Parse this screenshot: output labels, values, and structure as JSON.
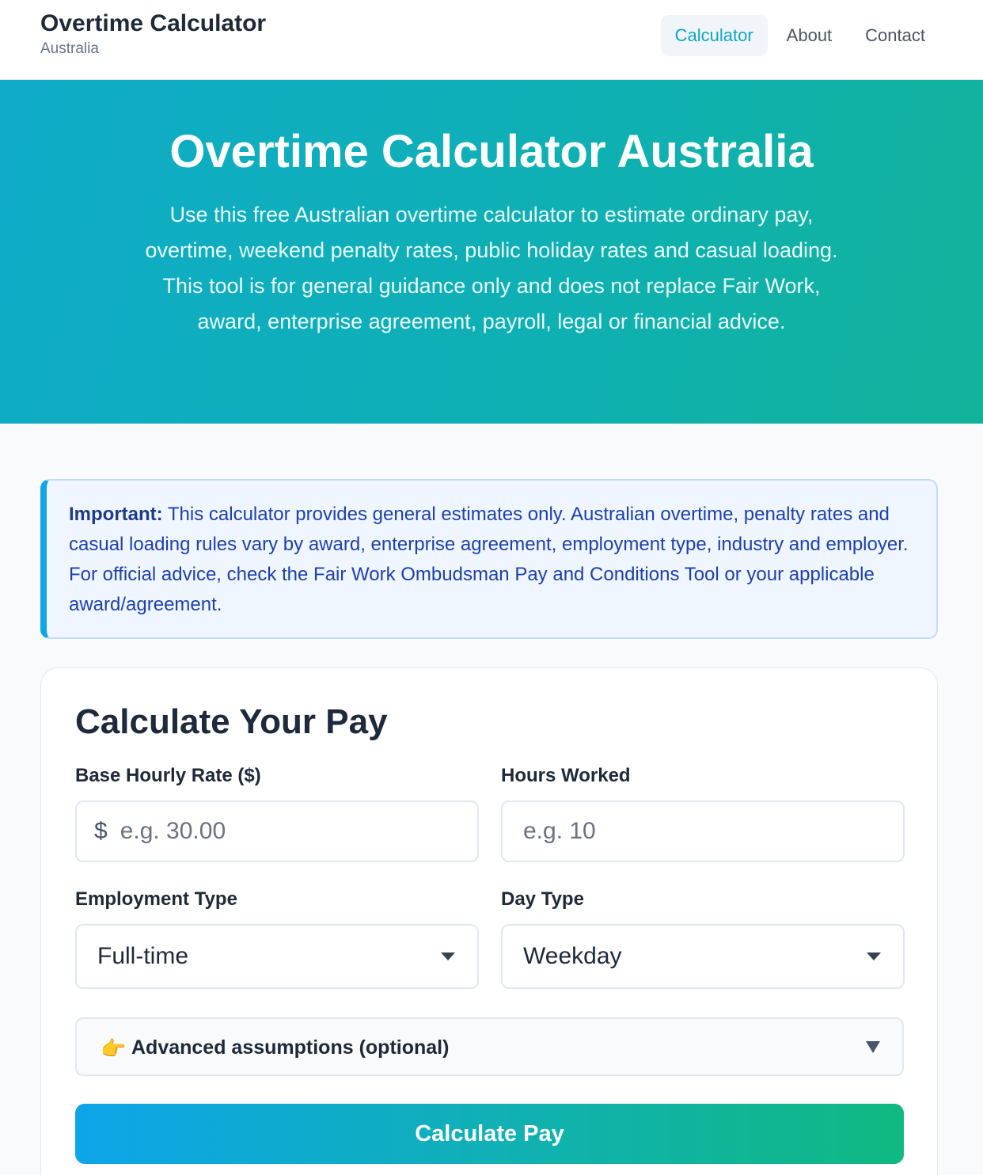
{
  "header": {
    "title": "Overtime Calculator",
    "subtitle": "Australia",
    "nav": [
      {
        "label": "Calculator",
        "active": true
      },
      {
        "label": "About",
        "active": false
      },
      {
        "label": "Contact",
        "active": false
      }
    ]
  },
  "hero": {
    "title": "Overtime Calculator Australia",
    "description": "Use this free Australian overtime calculator to estimate ordinary pay, overtime, weekend penalty rates, public holiday rates and casual loading. This tool is for general guidance only and does not replace Fair Work, award, enterprise agreement, payroll, legal or financial advice."
  },
  "notice": {
    "label": "Important:",
    "text": " This calculator provides general estimates only. Australian overtime, penalty rates and casual loading rules vary by award, enterprise agreement, employment type, industry and employer. For official advice, check the Fair Work Ombudsman Pay and Conditions Tool or your applicable award/agreement."
  },
  "form": {
    "title": "Calculate Your Pay",
    "base_rate": {
      "label": "Base Hourly Rate ($)",
      "prefix": "$",
      "placeholder": "e.g. 30.00",
      "value": ""
    },
    "hours": {
      "label": "Hours Worked",
      "placeholder": "e.g. 10",
      "value": ""
    },
    "employment_type": {
      "label": "Employment Type",
      "selected": "Full-time"
    },
    "day_type": {
      "label": "Day Type",
      "selected": "Weekday"
    },
    "advanced": {
      "icon": "pointing-hand-icon",
      "label": "Advanced assumptions (optional)"
    },
    "submit_label": "Calculate Pay"
  },
  "colors": {
    "accent": "#0ea5c9",
    "hero_start": "#0fabc9",
    "hero_end": "#12b39a",
    "notice_text": "#1e40af"
  }
}
